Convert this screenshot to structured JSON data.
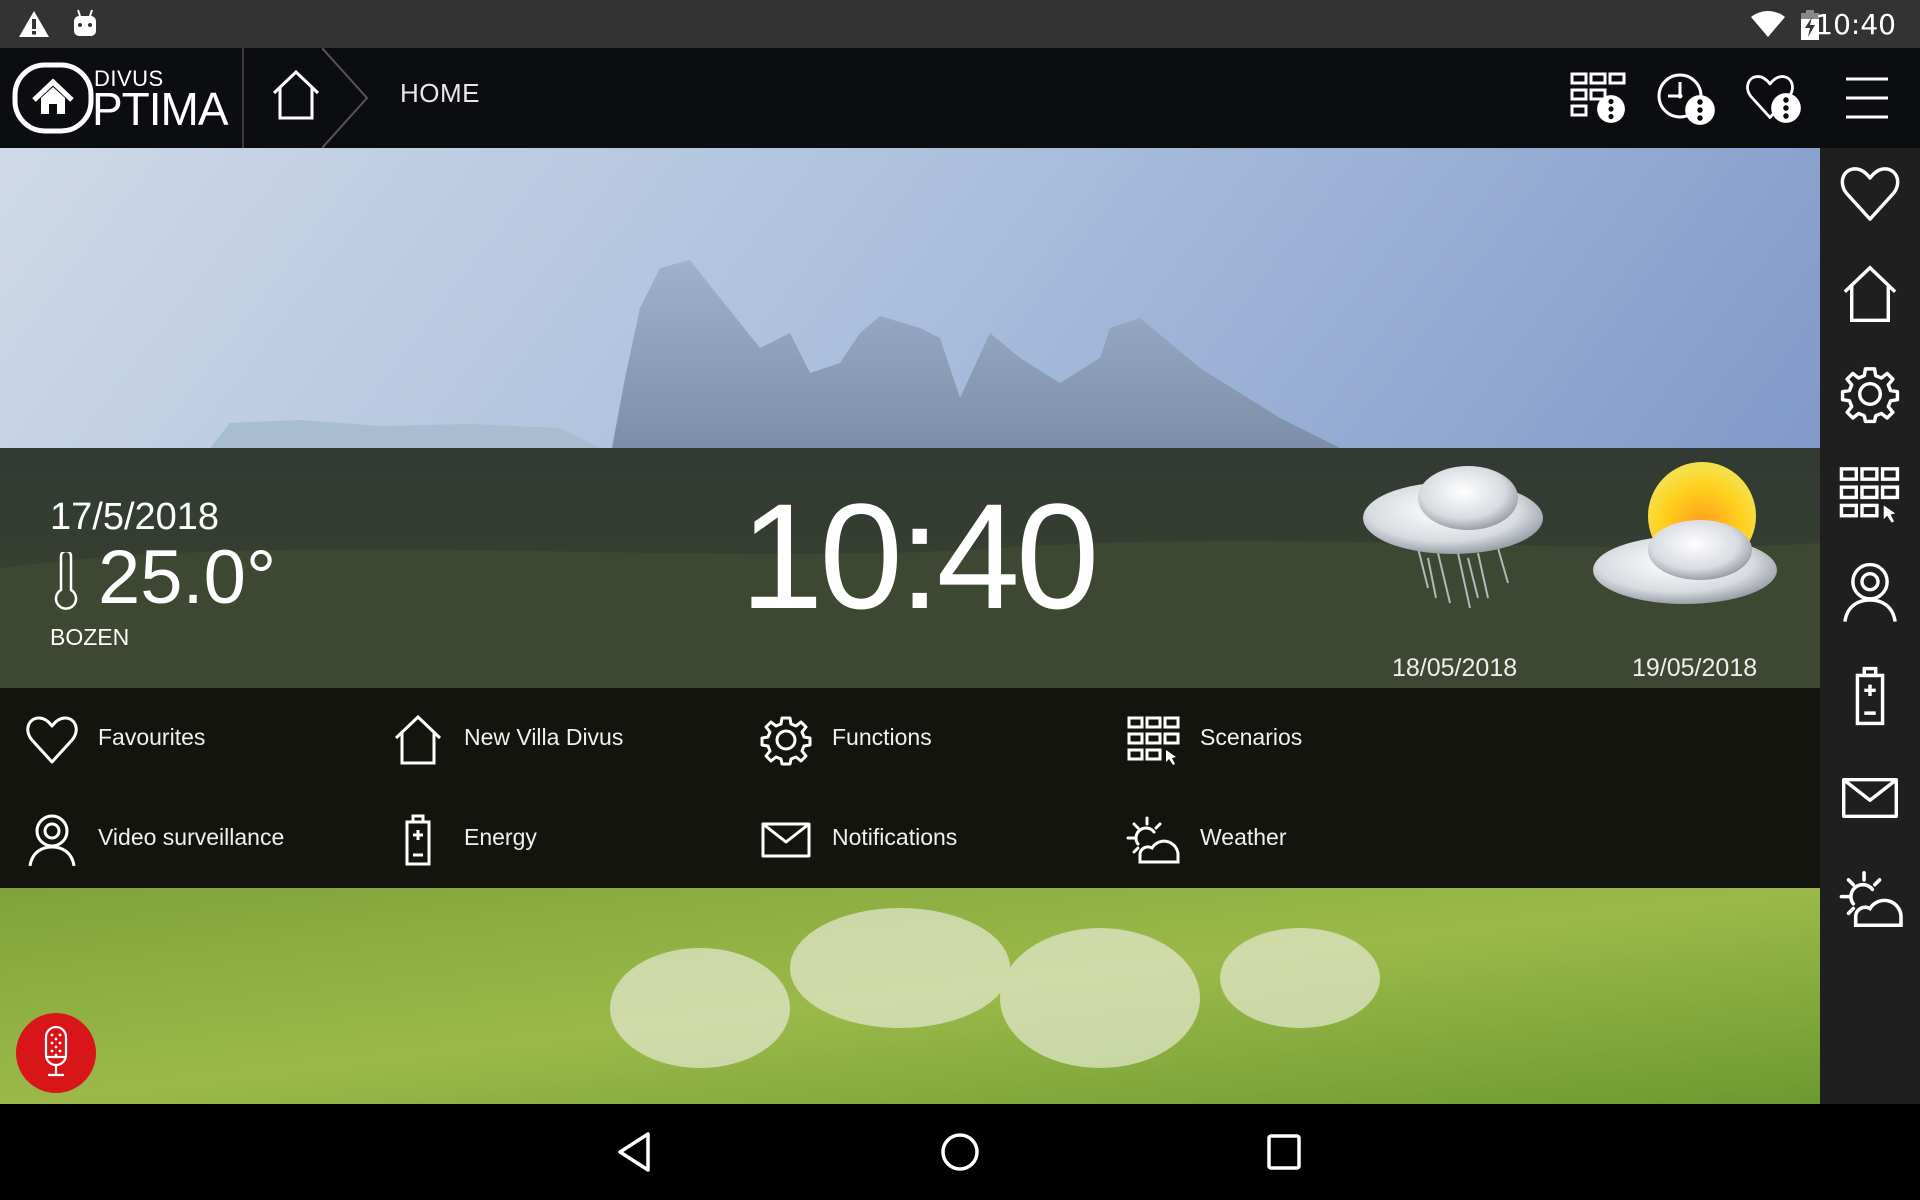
{
  "status_bar": {
    "left_icons": [
      "warning-icon",
      "android-debug-icon"
    ],
    "right_icons": [
      "wifi-icon",
      "battery-charging-icon"
    ],
    "time": "10:40"
  },
  "header": {
    "logo_top": "DIVUS",
    "logo_bottom": "PTIMA",
    "breadcrumb": "HOME",
    "actions": [
      {
        "icon": "scenarios-more-icon",
        "label": "Scenarios options"
      },
      {
        "icon": "clock-more-icon",
        "label": "Timers options"
      },
      {
        "icon": "favourite-more-icon",
        "label": "Favourites options"
      },
      {
        "icon": "hamburger-menu-icon",
        "label": "Menu"
      }
    ]
  },
  "weather": {
    "date": "17/5/2018",
    "temperature": "25.0°",
    "city": "BOZEN",
    "clock": "10:40",
    "forecast": [
      {
        "date": "18/05/2018",
        "condition": "rain"
      },
      {
        "date": "19/05/2018",
        "condition": "partly-sunny"
      }
    ]
  },
  "menu": {
    "items": [
      {
        "label": "Favourites",
        "icon": "heart-icon"
      },
      {
        "label": "New Villa Divus",
        "icon": "house-icon"
      },
      {
        "label": "Functions",
        "icon": "gear-icon"
      },
      {
        "label": "Scenarios",
        "icon": "scenarios-grid-icon"
      },
      {
        "label": "Video surveillance",
        "icon": "webcam-icon"
      },
      {
        "label": "Energy",
        "icon": "battery-icon"
      },
      {
        "label": "Notifications",
        "icon": "envelope-icon"
      },
      {
        "label": "Weather",
        "icon": "sun-cloud-icon"
      }
    ]
  },
  "sidebar": {
    "items": [
      {
        "icon": "heart-icon",
        "label": "Favourites"
      },
      {
        "icon": "house-icon",
        "label": "Home"
      },
      {
        "icon": "gear-icon",
        "label": "Functions"
      },
      {
        "icon": "scenarios-grid-icon",
        "label": "Scenarios"
      },
      {
        "icon": "webcam-icon",
        "label": "Video surveillance"
      },
      {
        "icon": "battery-icon",
        "label": "Energy"
      },
      {
        "icon": "envelope-icon",
        "label": "Notifications"
      },
      {
        "icon": "sun-cloud-icon",
        "label": "Weather"
      }
    ]
  },
  "voice_button": {
    "icon": "microphone-icon",
    "color": "#d8161a"
  },
  "nav_bar": {
    "buttons": [
      "back",
      "home",
      "recents"
    ]
  }
}
